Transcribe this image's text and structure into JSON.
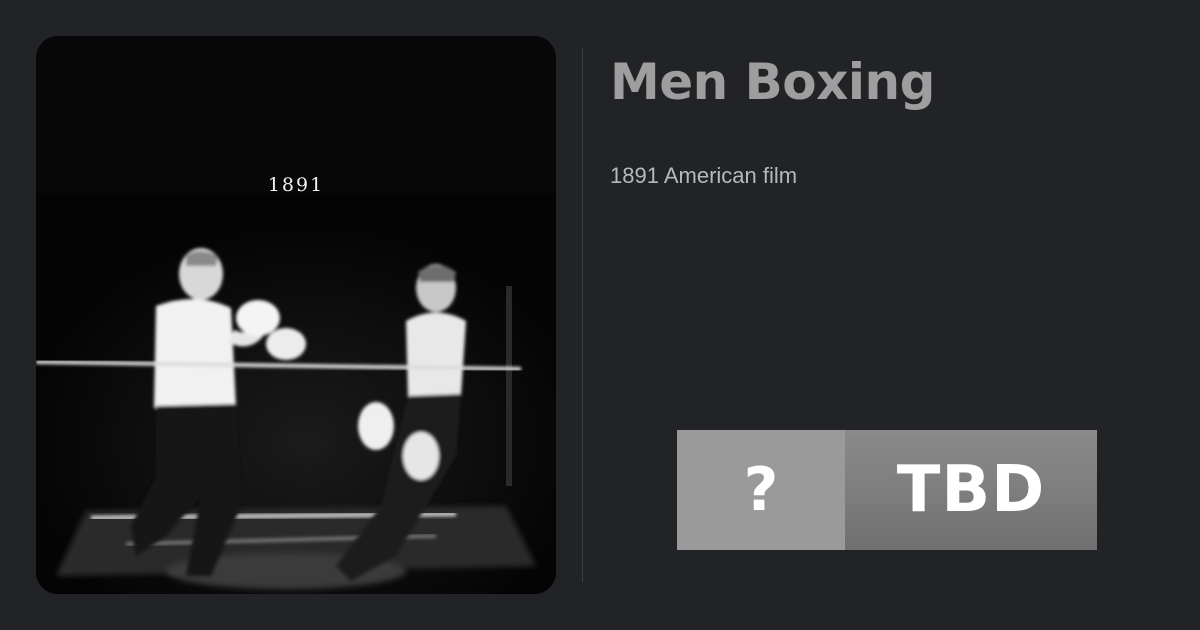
{
  "film": {
    "title": "Men Boxing",
    "description": "1891 American film",
    "poster_caption": "1891",
    "poster_alt": "Still frame of two men boxing in a ring"
  },
  "rating": {
    "icon": "question-mark",
    "icon_text": "?",
    "label": "TBD",
    "colors": {
      "icon_bg": "#9a9a9a",
      "label_bg": "#7d7d7d"
    }
  },
  "theme": {
    "background": "#212327",
    "title_color": "#9e9e9e",
    "text_color": "#b5b8bd"
  }
}
